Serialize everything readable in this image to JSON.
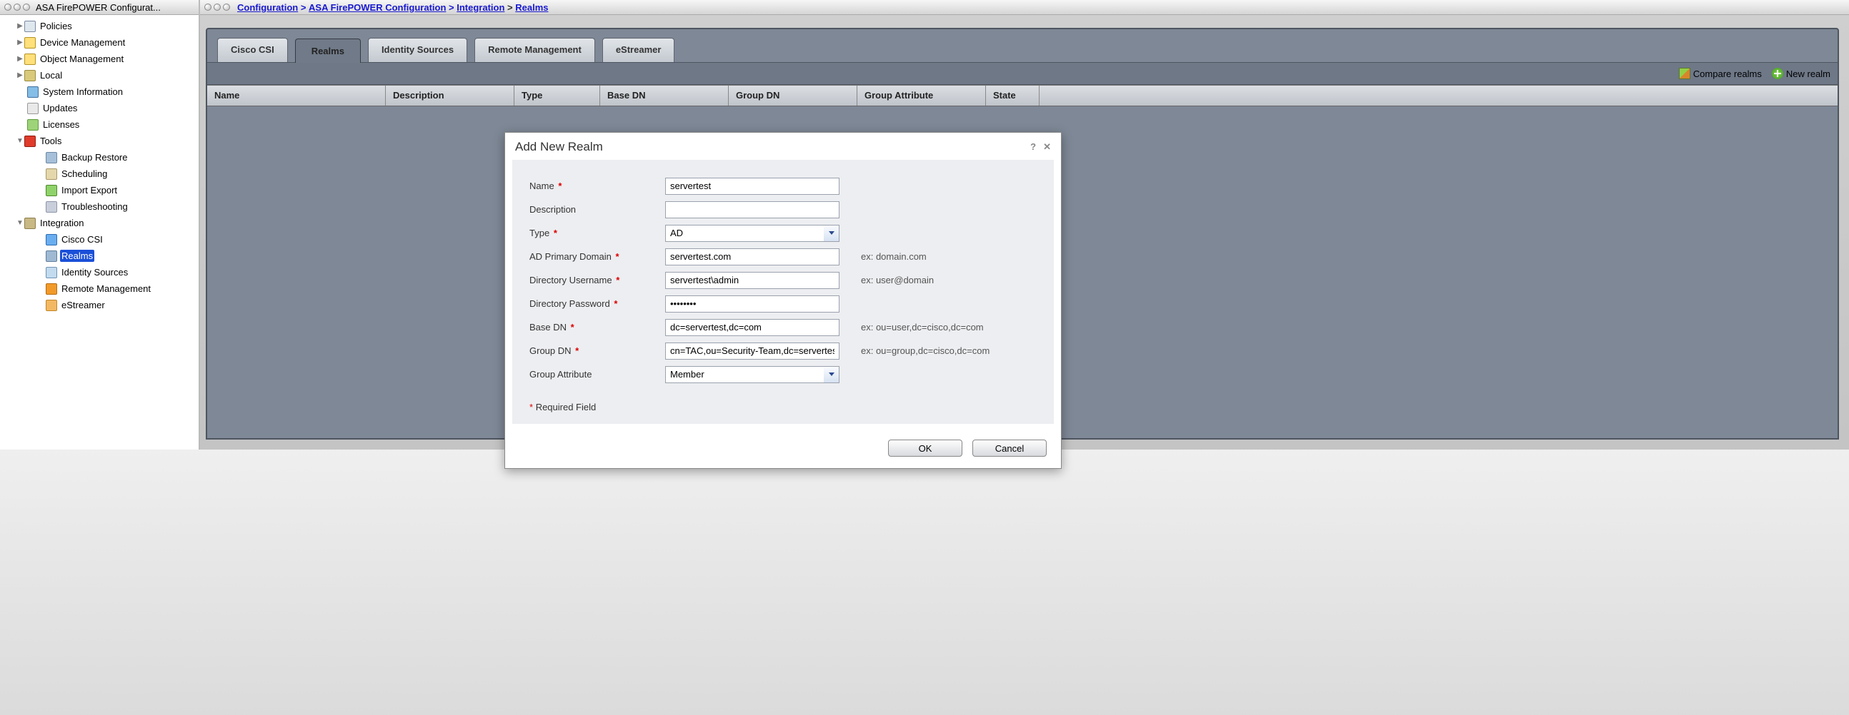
{
  "window": {
    "title": "ASA FirePOWER Configurat..."
  },
  "breadcrumb": {
    "parts": [
      "Configuration",
      "ASA FirePOWER Configuration",
      "Integration",
      "Realms"
    ]
  },
  "sidebar": {
    "items": [
      {
        "label": "Policies"
      },
      {
        "label": "Device Management"
      },
      {
        "label": "Object Management"
      },
      {
        "label": "Local"
      },
      {
        "label": "System Information"
      },
      {
        "label": "Updates"
      },
      {
        "label": "Licenses"
      },
      {
        "label": "Tools"
      },
      {
        "label": "Backup Restore"
      },
      {
        "label": "Scheduling"
      },
      {
        "label": "Import Export"
      },
      {
        "label": "Troubleshooting"
      },
      {
        "label": "Integration"
      },
      {
        "label": "Cisco CSI"
      },
      {
        "label": "Realms"
      },
      {
        "label": "Identity Sources"
      },
      {
        "label": "Remote Management"
      },
      {
        "label": "eStreamer"
      }
    ]
  },
  "tabs": {
    "items": [
      {
        "label": "Cisco CSI"
      },
      {
        "label": "Realms"
      },
      {
        "label": "Identity Sources"
      },
      {
        "label": "Remote Management"
      },
      {
        "label": "eStreamer"
      }
    ]
  },
  "actions": {
    "compare": "Compare realms",
    "new": "New realm"
  },
  "table": {
    "headers": [
      "Name",
      "Description",
      "Type",
      "Base DN",
      "Group DN",
      "Group Attribute",
      "State"
    ]
  },
  "dialog": {
    "title": "Add New Realm",
    "fields": {
      "name_label": "Name",
      "description_label": "Description",
      "type_label": "Type",
      "pdomain_label": "AD Primary Domain",
      "duser_label": "Directory Username",
      "dpass_label": "Directory Password",
      "basedn_label": "Base DN",
      "groupdn_label": "Group DN",
      "groupattr_label": "Group Attribute"
    },
    "values": {
      "name": "servertest",
      "description": "",
      "type": "AD",
      "pdomain": "servertest.com",
      "duser": "servertest\\admin",
      "dpass": "••••••••",
      "basedn": "dc=servertest,dc=com",
      "groupdn": "cn=TAC,ou=Security-Team,dc=servertest,dc=com",
      "groupattr": "Member"
    },
    "hints": {
      "pdomain": "ex: domain.com",
      "duser": "ex: user@domain",
      "basedn": "ex: ou=user,dc=cisco,dc=com",
      "groupdn": "ex: ou=group,dc=cisco,dc=com"
    },
    "required_note_star": "*",
    "required_note_text": "Required Field",
    "buttons": {
      "ok": "OK",
      "cancel": "Cancel"
    },
    "help": "?",
    "close": "✕"
  }
}
